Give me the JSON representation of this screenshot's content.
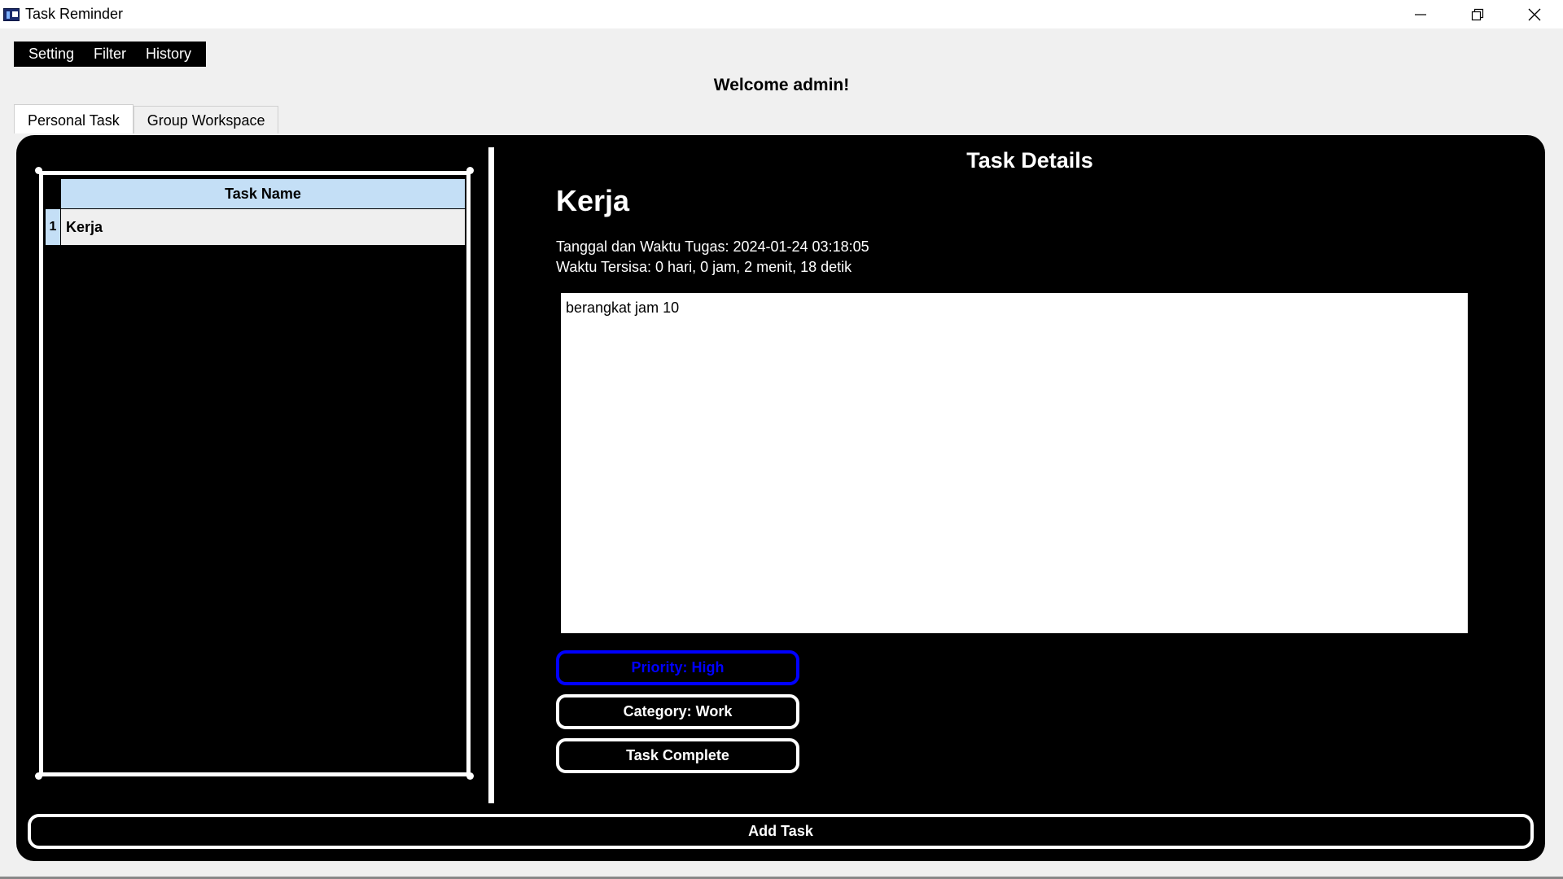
{
  "window": {
    "title": "Task Reminder"
  },
  "menu": {
    "items": [
      "Setting",
      "Filter",
      "History"
    ]
  },
  "welcome": "Welcome admin!",
  "tabs": [
    {
      "label": "Personal Task",
      "active": true
    },
    {
      "label": "Group Workspace",
      "active": false
    }
  ],
  "task_table": {
    "header": "Task Name",
    "rows": [
      {
        "num": "1",
        "name": "Kerja"
      }
    ]
  },
  "details": {
    "title": "Task Details",
    "task_name": "Kerja",
    "datetime_line": "Tanggal dan Waktu Tugas: 2024-01-24 03:18:05",
    "remaining_line": "Waktu Tersisa: 0 hari, 0 jam, 2 menit, 18 detik",
    "description": "berangkat jam 10",
    "priority_label": "Priority: High",
    "category_label": "Category: Work",
    "complete_label": "Task Complete"
  },
  "add_task_label": "Add Task",
  "colors": {
    "panel": "#000000",
    "priority": "#0000ff",
    "table_header": "#c4dff6"
  },
  "icons": [
    "app-icon",
    "minimize-icon",
    "maximize-icon",
    "close-icon"
  ]
}
